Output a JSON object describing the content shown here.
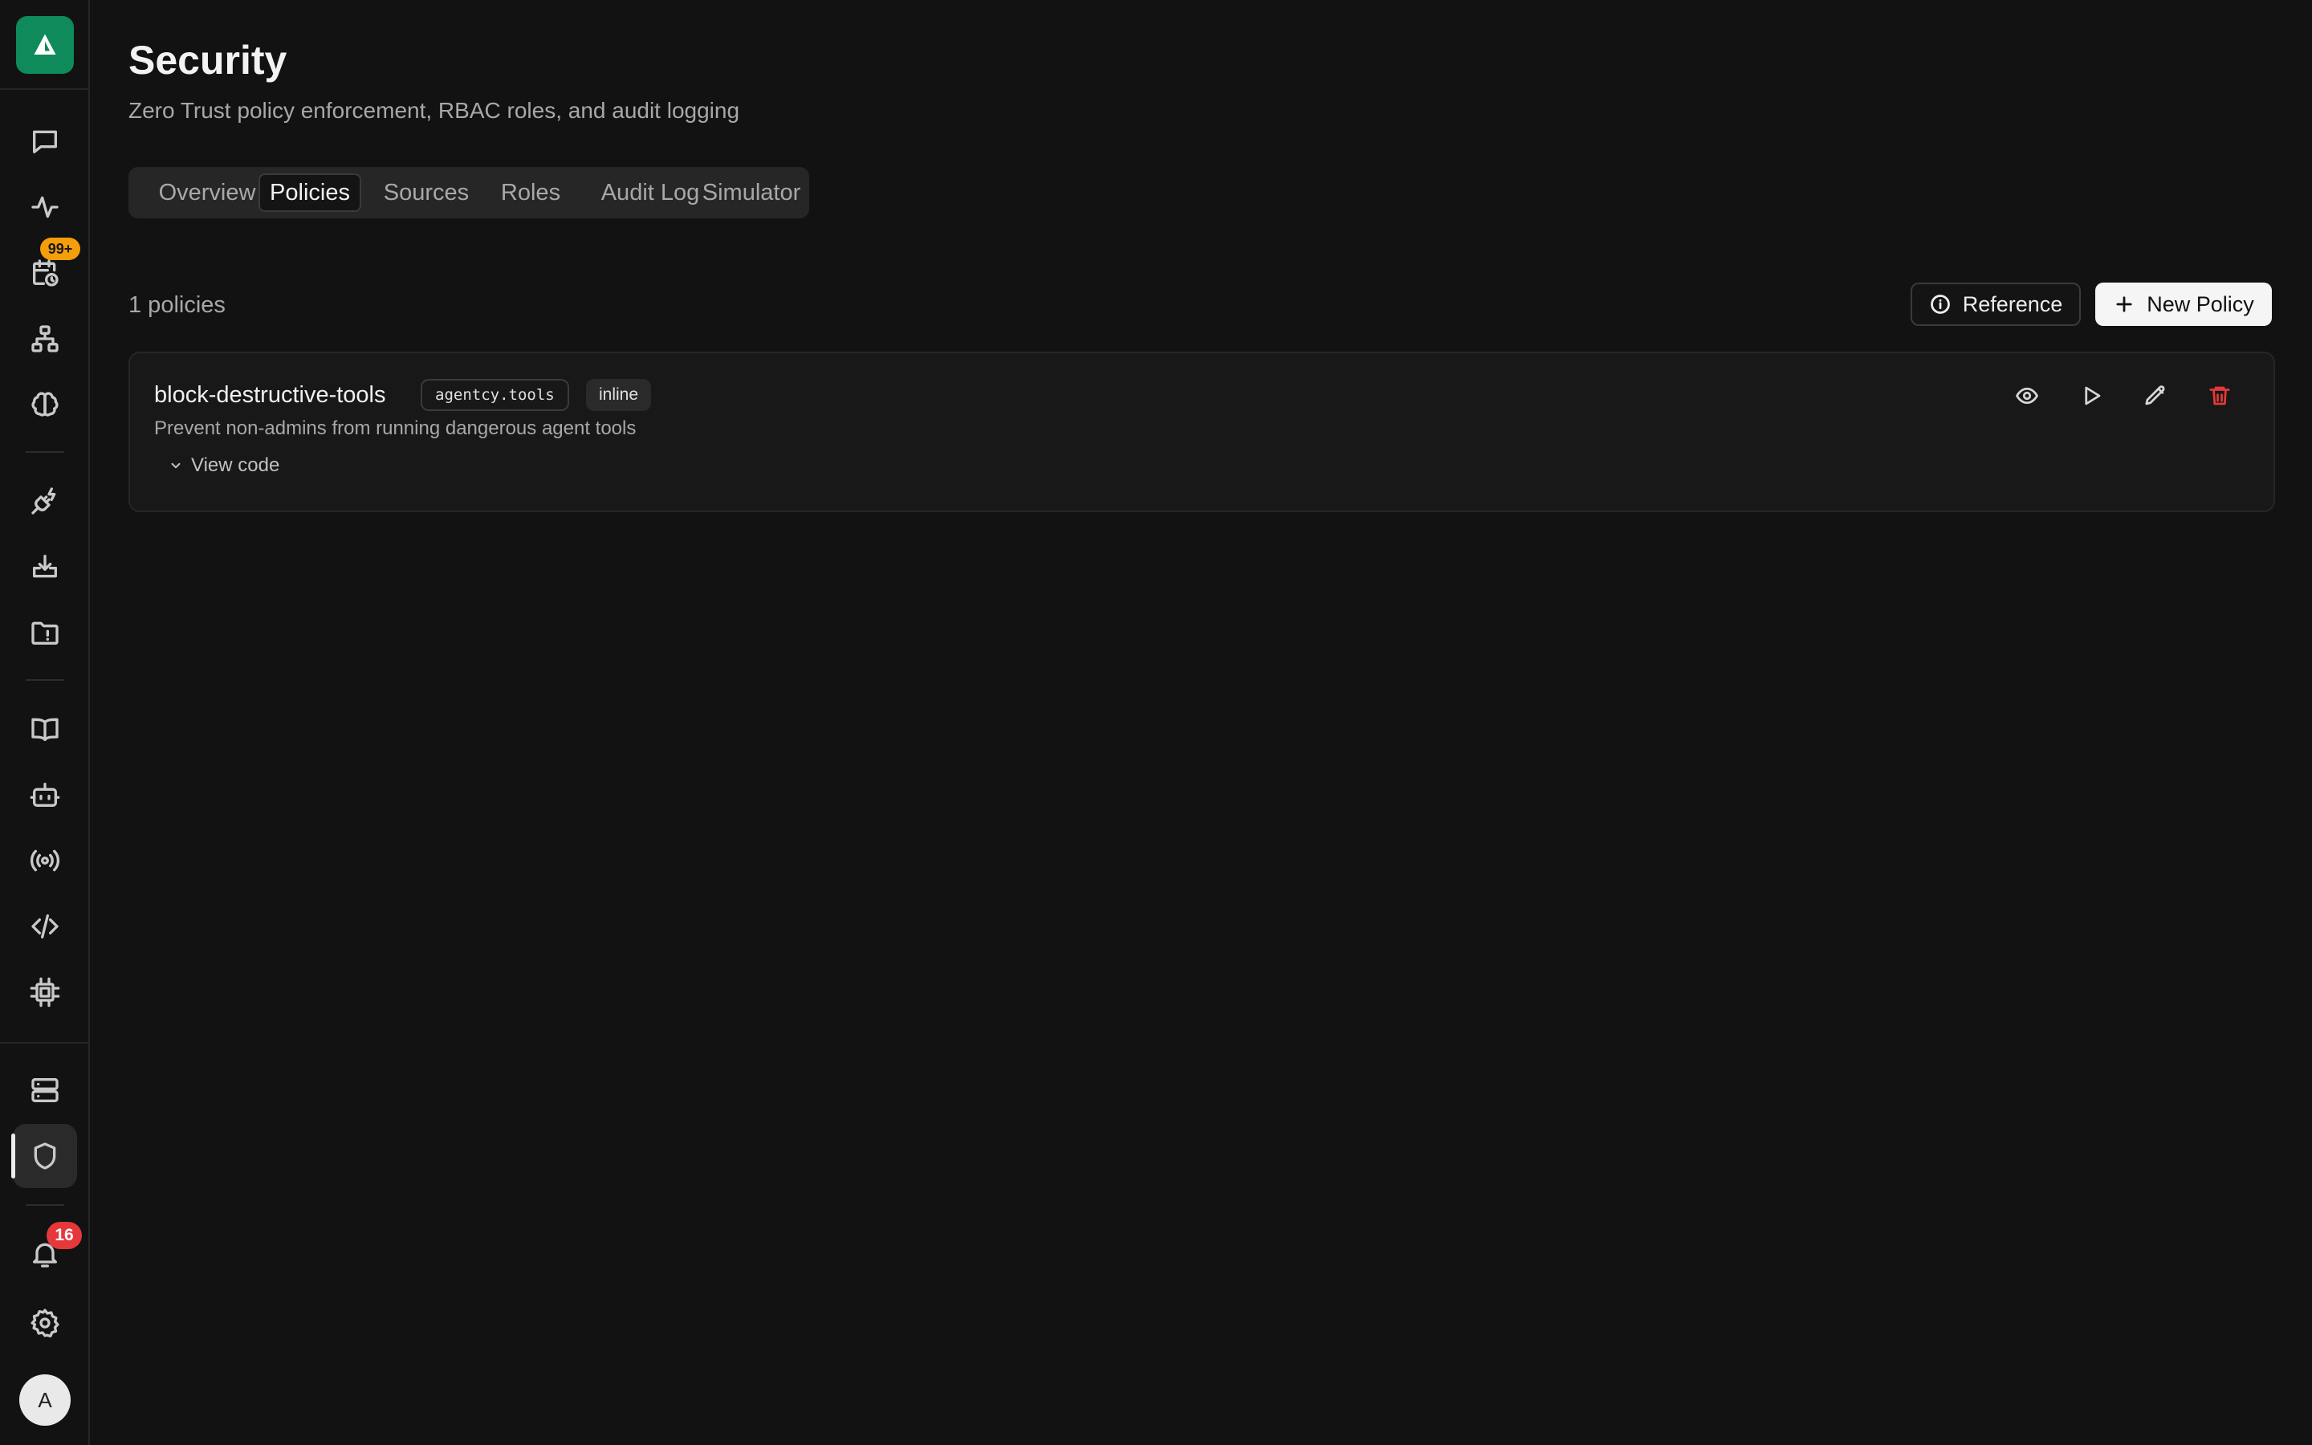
{
  "page": {
    "title": "Security",
    "subtitle": "Zero Trust policy enforcement, RBAC roles, and audit logging"
  },
  "tabs": [
    {
      "label": "Overview",
      "active": false
    },
    {
      "label": "Policies",
      "active": true
    },
    {
      "label": "Sources",
      "active": false
    },
    {
      "label": "Roles",
      "active": false
    },
    {
      "label": "Audit Log",
      "active": false
    },
    {
      "label": "Simulator",
      "active": false
    }
  ],
  "policies_count": "1 policies",
  "buttons": {
    "reference": "Reference",
    "new_policy": "New Policy"
  },
  "policy": {
    "name": "block-destructive-tools",
    "package": "agentcy.tools",
    "type": "inline",
    "description": "Prevent non-admins from running dangerous agent tools",
    "view_code": "View code"
  },
  "sidebar": {
    "icons": [
      "logo-icon",
      "chat-icon",
      "activity-icon",
      "schedule-icon",
      "network-icon",
      "brain-icon",
      "plug-icon",
      "download-icon",
      "folder-icon",
      "book-icon",
      "bot-icon",
      "broadcast-icon",
      "code-icon",
      "chip-icon",
      "server-icon",
      "shield-icon",
      "bell-icon",
      "gear-icon"
    ],
    "schedule_badge": "99+",
    "notifications_badge": "16",
    "avatar_initial": "A",
    "logo_color": "#0f8a5a"
  },
  "colors": {
    "accent": "#0f8a5a",
    "danger": "#e5383b",
    "badge_orange": "#f59e0b"
  }
}
